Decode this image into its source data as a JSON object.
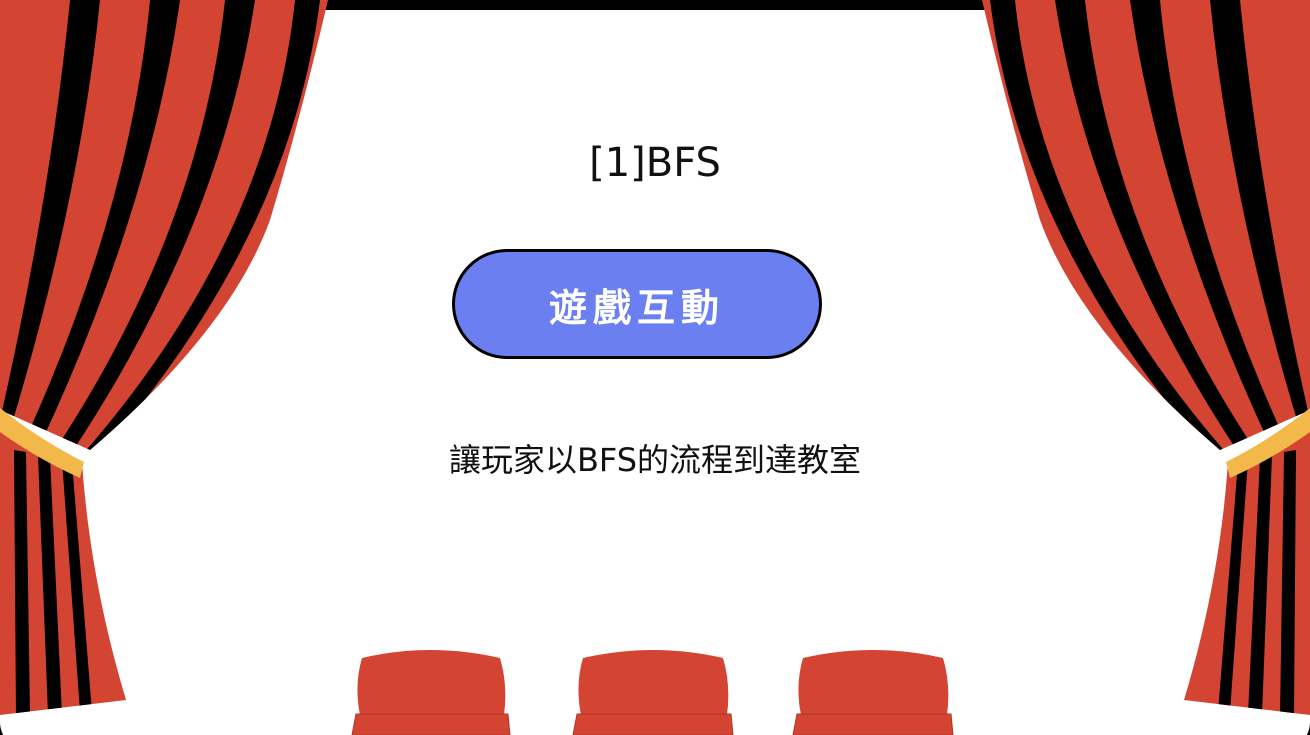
{
  "stage": {
    "title": "[1]BFS",
    "play_button_label": "遊戲互動",
    "description": "讓玩家以BFS的流程到達教室"
  },
  "icons": {
    "curtain_left": "stage-curtain-left-icon",
    "curtain_right": "stage-curtain-right-icon",
    "seats": "theater-seat-icon"
  },
  "colors": {
    "curtain_red": "#d44433",
    "curtain_stripe": "#000000",
    "tieback": "#f2b94a",
    "button": "#6b7ff0",
    "seat": "#d44433"
  }
}
